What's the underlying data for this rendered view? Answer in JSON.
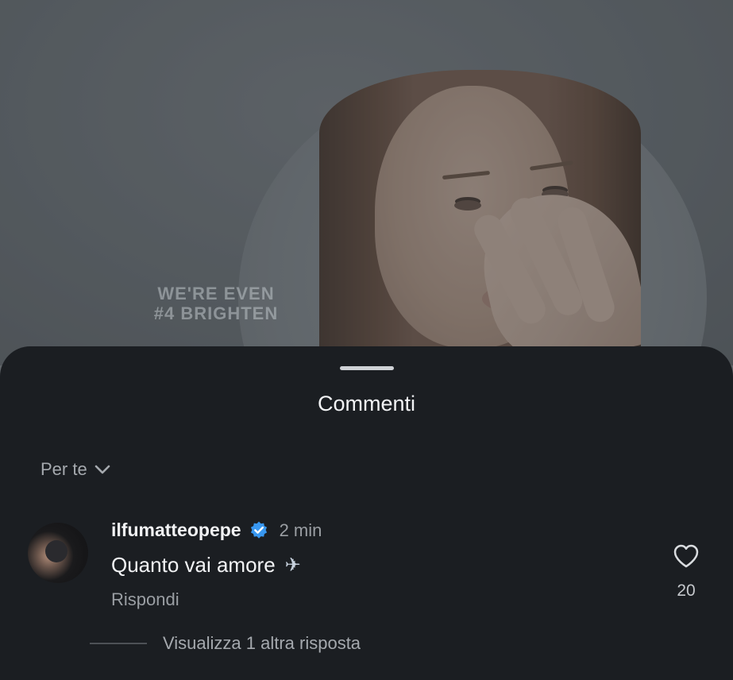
{
  "video": {
    "overlay_line1": "WE'RE EVEN",
    "overlay_line2": "#4 BRIGHTEN"
  },
  "comments_sheet": {
    "title": "Commenti",
    "sort_label": "Per te",
    "comment": {
      "username": "ilfumatteopepe",
      "verified": true,
      "time": "2 min",
      "text": "Quanto vai amore",
      "emoji_icon": "airplane-icon",
      "reply_label": "Rispondi",
      "like_count": "20"
    },
    "view_replies_label": "Visualizza 1 altra risposta"
  },
  "colors": {
    "sheet_background": "#1b1e22",
    "verified_badge": "#3897f0",
    "primary_text": "#f2f3f5",
    "secondary_text": "#9a9ea3"
  }
}
